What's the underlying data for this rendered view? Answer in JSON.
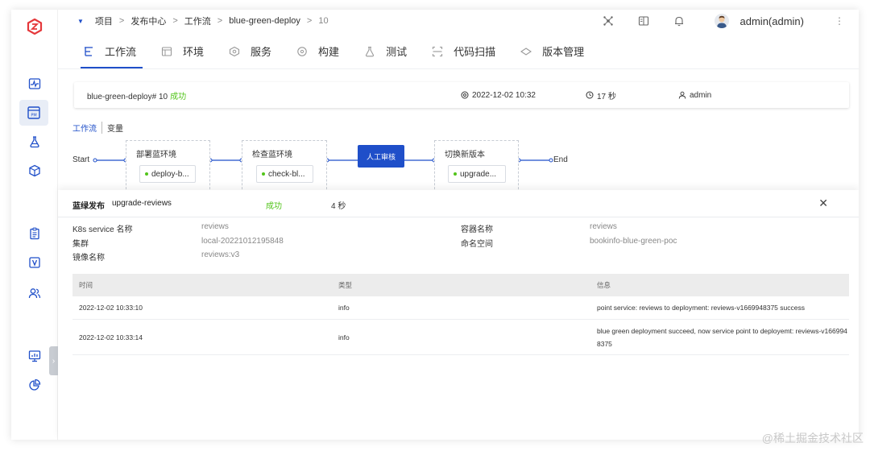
{
  "breadcrumb": [
    "项目",
    "发布中心",
    "工作流",
    "blue-green-deploy",
    "10"
  ],
  "user": {
    "name": "admin(admin)"
  },
  "tabs": [
    {
      "label": "工作流",
      "icon": "workflow-icon",
      "active": true
    },
    {
      "label": "环境",
      "icon": "environment-icon"
    },
    {
      "label": "服务",
      "icon": "service-icon"
    },
    {
      "label": "构建",
      "icon": "build-icon"
    },
    {
      "label": "测试",
      "icon": "test-icon"
    },
    {
      "label": "代码扫描",
      "icon": "code-scan-icon"
    },
    {
      "label": "版本管理",
      "icon": "version-icon"
    }
  ],
  "task": {
    "name": "blue-green-deploy# 10",
    "status": "成功",
    "time": "2022-12-02 10:32",
    "duration": "17 秒",
    "user": "admin"
  },
  "subtabs": {
    "workflow": "工作流",
    "variables": "变量"
  },
  "pipeline": {
    "start": "Start",
    "end": "End",
    "stages": [
      {
        "title": "部署蓝环境",
        "job": "deploy-b..."
      },
      {
        "title": "检查蓝环境",
        "job": "check-bl..."
      },
      {
        "title": "人工审核"
      },
      {
        "title": "切换新版本",
        "job": "upgrade..."
      }
    ]
  },
  "detail": {
    "title": "蓝绿发布",
    "name": "upgrade-reviews",
    "status": "成功",
    "duration": "4 秒",
    "fields": {
      "k8s_service_label": "K8s service 名称",
      "k8s_service_value": "reviews",
      "cluster_label": "集群",
      "cluster_value": "local-20221012195848",
      "image_label": "镜像名称",
      "image_value": "reviews:v3",
      "container_label": "容器名称",
      "container_value": "reviews",
      "namespace_label": "命名空间",
      "namespace_value": "bookinfo-blue-green-poc"
    },
    "table": {
      "headers": [
        "时间",
        "类型",
        "信息"
      ],
      "rows": [
        {
          "time": "2022-12-02 10:33:10",
          "type": "info",
          "info": "point service: reviews to deployment: reviews-v1669948375 success"
        },
        {
          "time": "2022-12-02 10:33:14",
          "type": "info",
          "info": "blue green deployment succeed, now service point to deployemt: reviews-v1669948375"
        }
      ]
    }
  },
  "watermark": "@稀土掘金技术社区",
  "colors": {
    "accent": "#1f4fc9",
    "success": "#52c41a",
    "brand": "#e5383b"
  }
}
